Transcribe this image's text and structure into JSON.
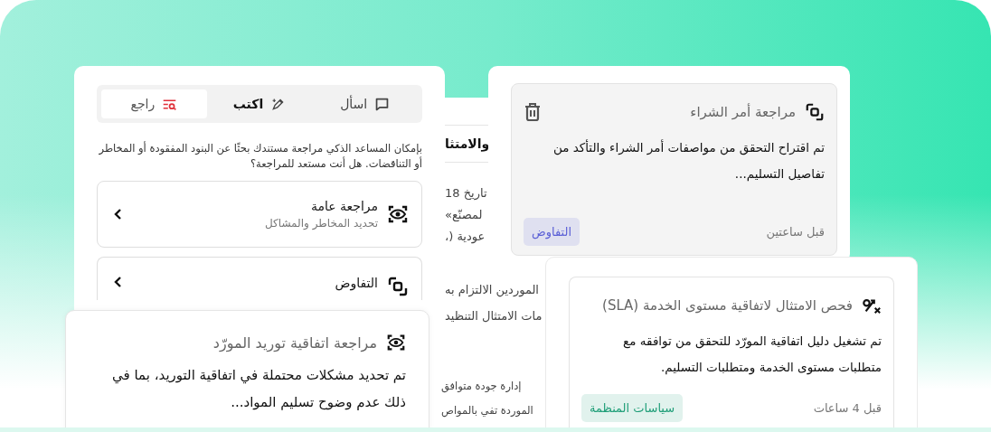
{
  "assistant": {
    "tabs": [
      {
        "label": "اسأل",
        "selected": false
      },
      {
        "label": "اكتب",
        "selected": false
      },
      {
        "label": "راجع",
        "selected": true
      }
    ],
    "intro": "بإمكان المساعد الذكي مراجعة مستندك بحثًا عن البنود المفقودة أو المخاطر أو التناقضات. هل أنت مستعد للمراجعة؟",
    "options": [
      {
        "title": "مراجعة عامة",
        "subtitle": "تحديد المخاطر والمشاكل"
      },
      {
        "title": "التفاوض"
      }
    ]
  },
  "document": {
    "heading": "والامتثا",
    "lines_top": [
      "تاريخ 18",
      "لمصنّع»",
      "عودية (،"
    ],
    "lines_middle": [
      "الموردين الالتزام به",
      "مات الامتثال التنظيد"
    ],
    "lines_bottom": [
      "إدارة جودة متوافق",
      "الموردة تفي بالمواص"
    ]
  },
  "purchase_card": {
    "title": "مراجعة أمر الشراء",
    "body": "تم اقتراح التحقق من مواصفات أمر الشراء والتأكد من تفاصيل التسليم...",
    "time": "قبل ساعتين",
    "tag": {
      "label": "التفاوض",
      "color": "#5a5fd6"
    }
  },
  "sla_card": {
    "title": "فحص الامتثال لاتفاقية مستوى الخدمة (SLA)",
    "body": "تم تشغيل دليل اتفاقية المورّد للتحقق من توافقه مع متطلبات مستوى الخدمة ومتطلبات التسليم.",
    "time": "قبل 4 ساعات",
    "tag": {
      "label": "سياسات المنظمة",
      "color": "#1f9e78"
    }
  },
  "supplier_card": {
    "title": "مراجعة اتفاقية توريد المورّد",
    "body": "تم تحديد مشكلات محتملة في اتفاقية التوريد، بما في ذلك عدم وضوح تسليم المواد..."
  }
}
